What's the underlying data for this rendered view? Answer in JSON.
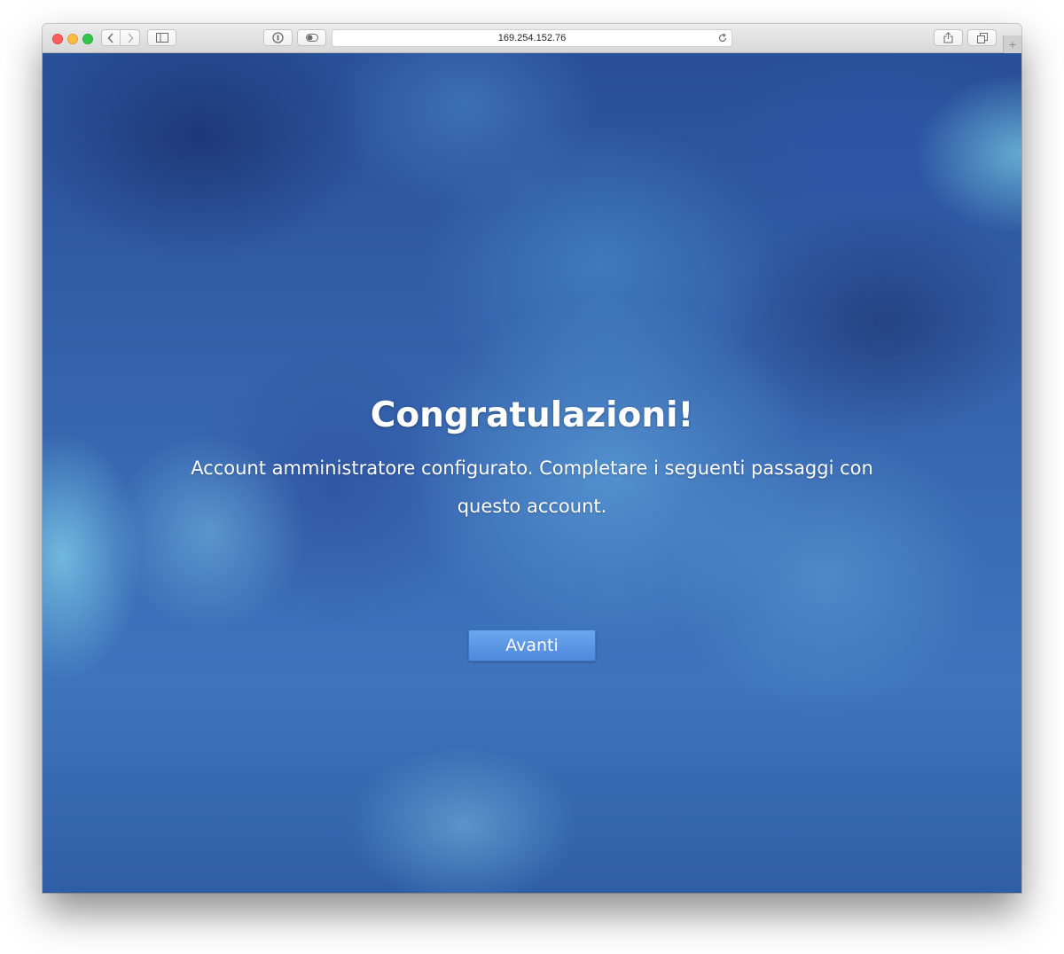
{
  "browser": {
    "address": "169.254.152.76",
    "icons": {
      "close": "close-icon",
      "minimize": "minimize-icon",
      "maximize": "maximize-icon",
      "back": "chevron-left-icon",
      "forward": "chevron-right-icon",
      "sidebar": "sidebar-icon",
      "privacy": "privacy-icon",
      "reader": "toggle-icon",
      "reload": "reload-icon",
      "share": "share-icon",
      "tabs": "tabs-icon",
      "new_tab": "plus-icon"
    },
    "new_tab_glyph": "+"
  },
  "page": {
    "title": "Congratulazioni!",
    "message": "Account amministratore configurato. Completare i seguenti passaggi con questo account.",
    "next_button_label": "Avanti",
    "accent_color": "#5b95e4"
  }
}
